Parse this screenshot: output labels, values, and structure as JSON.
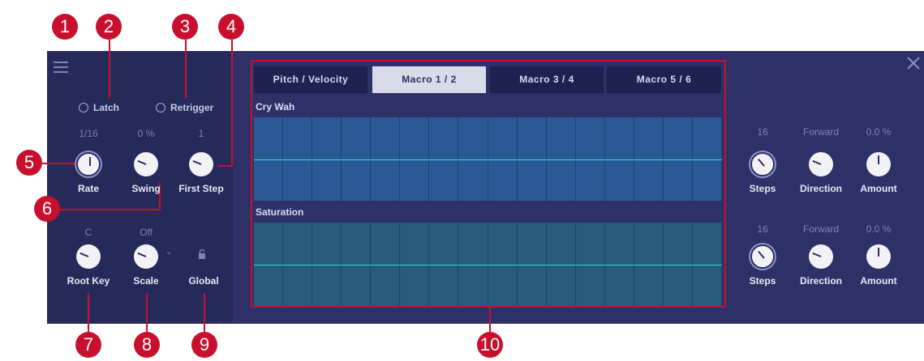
{
  "callouts": [
    "1",
    "2",
    "3",
    "4",
    "5",
    "6",
    "7",
    "8",
    "9",
    "10"
  ],
  "sidebar": {
    "latch_label": "Latch",
    "retrigger_label": "Retrigger",
    "knobs": [
      {
        "value": "1/16",
        "label": "Rate",
        "level": 0.5
      },
      {
        "value": "0 %",
        "label": "Swing",
        "level": 0.25
      },
      {
        "value": "1",
        "label": "First Step",
        "level": 0.25
      },
      {
        "value": "C",
        "label": "Root Key",
        "level": 0.25
      },
      {
        "value": "Off",
        "label": "Scale",
        "level": 0.25
      }
    ],
    "global_label": "Global",
    "icons": [
      "menu-icon",
      "lock-icon",
      "chevron-down-icon"
    ]
  },
  "tabs": [
    "Pitch / Velocity",
    "Macro 1 / 2",
    "Macro 3 / 4",
    "Macro 5 / 6"
  ],
  "active_tab": "Macro 1 / 2",
  "lanes": [
    {
      "name": "Cry Wah",
      "steps": 16,
      "line_level": 0.5,
      "color": "#2a5a94"
    },
    {
      "name": "Saturation",
      "steps": 16,
      "line_level": 0.5,
      "color": "#285c7a"
    }
  ],
  "lane_controls": [
    {
      "steps_value": "16",
      "steps_label": "Steps",
      "direction_value": "Forward",
      "direction_label": "Direction",
      "amount_value": "0.0 %",
      "amount_label": "Amount"
    },
    {
      "steps_value": "16",
      "steps_label": "Steps",
      "direction_value": "Forward",
      "direction_label": "Direction",
      "amount_value": "0.0 %",
      "amount_label": "Amount"
    }
  ],
  "close_icon": "close-icon",
  "colors": {
    "accent": "#c8102e",
    "lane_line": "#31d6d2",
    "panel_left": "#262a5a",
    "panel_main": "#2e3168"
  }
}
